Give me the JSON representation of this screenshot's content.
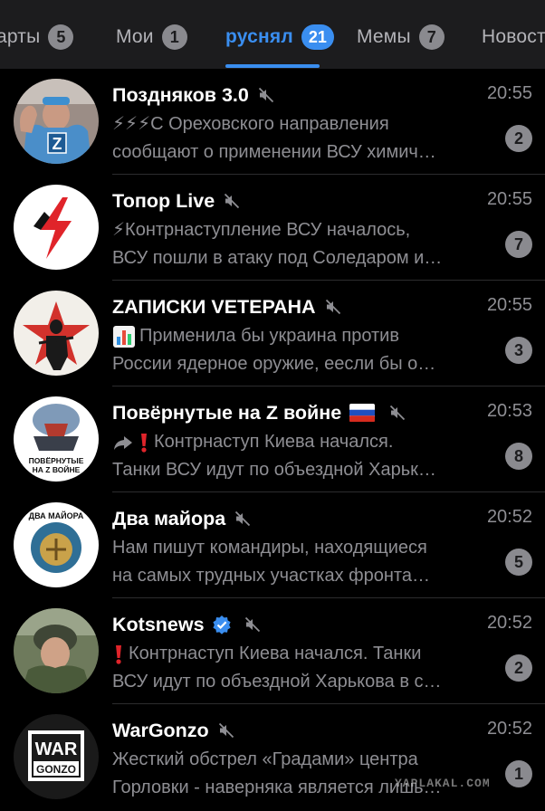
{
  "tabs": [
    {
      "label": "арты",
      "badge": "5",
      "active": false
    },
    {
      "label": "Мои",
      "badge": "1",
      "active": false
    },
    {
      "label": "руснял",
      "badge": "21",
      "active": true
    },
    {
      "label": "Мемы",
      "badge": "7",
      "active": false
    },
    {
      "label": "Новост",
      "badge": "",
      "active": false
    }
  ],
  "chats": [
    {
      "title": "Поздняков 3.0",
      "time": "20:55",
      "preview_line1": "⚡⚡⚡С Ореховского направления",
      "preview_line2": "сообщают о применении ВСУ химич…",
      "unread": "2",
      "muted": true
    },
    {
      "title": "Топор Live",
      "time": "20:55",
      "preview_line1": "⚡Контрнаступление ВСУ началось,",
      "preview_line2": "ВСУ пошли в атаку под Соледаром и…",
      "unread": "7",
      "muted": true
    },
    {
      "title": "ZАПИСКИ VЕТЕРАНА",
      "time": "20:55",
      "preview_line1": "Применила бы украина против",
      "preview_line2": "России ядерное оружие, еесли бы о…",
      "unread": "3",
      "muted": true
    },
    {
      "title": "Повёрнутые на Z войне",
      "time": "20:53",
      "preview_line1": "Контрнаступ Киева начался.",
      "preview_line2": "Танки ВСУ идут по объездной Харьк…",
      "unread": "8",
      "muted": true,
      "avatar_text_1": "ПОВЁРНУТЫЕ",
      "avatar_text_2": "НА Z ВОЙНЕ"
    },
    {
      "title": "Два майора",
      "time": "20:52",
      "preview_line1": "Нам пишут командиры, находящиеся",
      "preview_line2": "на самых трудных участках фронта…",
      "unread": "5",
      "muted": true,
      "avatar_text": "ДВА МАЙОРА"
    },
    {
      "title": "Kotsnews",
      "time": "20:52",
      "preview_line1": "Контрнаступ Киева начался. Танки",
      "preview_line2": "ВСУ идут по объездной Харькова в с…",
      "unread": "2",
      "muted": true,
      "verified": true
    },
    {
      "title": "WarGonzo",
      "time": "20:52",
      "preview_line1": "Жесткий обстрел «Градами» центра",
      "preview_line2": "Горловки - наверняка является лишь…",
      "unread": "1",
      "muted": true,
      "avatar_text_1": "WAR",
      "avatar_text_2": "GONZO"
    }
  ],
  "watermark": "YAPLAKAL.COM",
  "colors": {
    "accent": "#3a8ef0",
    "background": "#000000",
    "tabbar": "#1c1c1e",
    "secondary_text": "#8e8e93",
    "badge": "#8a8a8f"
  }
}
